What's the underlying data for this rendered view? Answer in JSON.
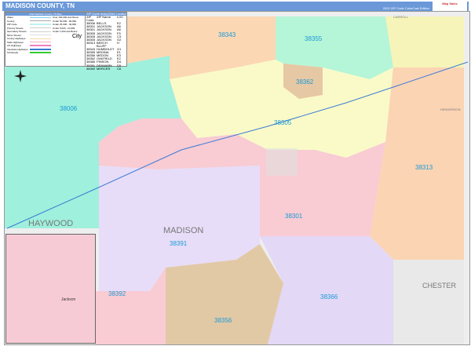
{
  "header": {
    "title": "MADISON COUNTY, TN",
    "edition": "2022 ZIP Code ColorCast Edition",
    "logo": "Map Sales"
  },
  "legend": {
    "title": "2022 Madison County, TN Map",
    "items": [
      "Water",
      "County",
      "ZIP Code",
      "Primary Streets",
      "Secondary Streets",
      "Minor Streets",
      "County Highways",
      "State Highways",
      "US Highways",
      "Interstate Highways",
      "Toll Roads"
    ],
    "populations": [
      "Over 100,000 and Above",
      "Under 50,000 - 99,999",
      "Under 25,000 - 49,999",
      "Under 5,000 - 24,999",
      "Under 1,000 and Below"
    ],
    "city_glyph": "City"
  },
  "zip_table": {
    "title": "ZIP Code Index/Grid Locator",
    "headers": [
      "ZIP Code",
      "ZIP Name",
      "LOC"
    ],
    "rows": [
      [
        "38006",
        "BELLS",
        "E2"
      ],
      [
        "38301",
        "JACKSON",
        "A6"
      ],
      [
        "38301",
        "JACKSON",
        "A6"
      ],
      [
        "38305",
        "JACKSON",
        "F5"
      ],
      [
        "38305",
        "JACKSON",
        "C3"
      ],
      [
        "38305",
        "JACKSON",
        "G2"
      ],
      [
        "38313",
        "BEECH BLUFF",
        "H"
      ],
      [
        "38343",
        "HUMBOLDT",
        "G1"
      ],
      [
        "38355",
        "MEDINA",
        "E1"
      ],
      [
        "38356",
        "MEDON",
        "E3"
      ],
      [
        "38362",
        "OAKFIELD",
        "E2"
      ],
      [
        "38366",
        "PINSON",
        "D4"
      ],
      [
        "38391",
        "DENMARK",
        "D5"
      ],
      [
        "38392",
        "MERCER",
        "C6"
      ]
    ]
  },
  "map": {
    "zip_labels": [
      "38343",
      "38355",
      "38362",
      "38006",
      "38305",
      "38313",
      "38301",
      "38391",
      "38392",
      "38366",
      "38356"
    ],
    "counties": [
      "HAYWOOD",
      "MADISON",
      "CHESTER",
      "CARROLL",
      "HENDERSON"
    ],
    "inset_label": "Jackson"
  }
}
